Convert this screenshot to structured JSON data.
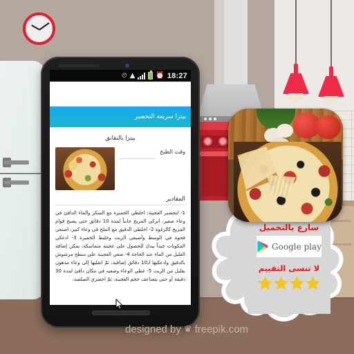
{
  "scene": {
    "title": "Pizza recipe app promo mockup in cartoon kitchen",
    "watermark": {
      "text_before": "designed by",
      "icon": "freepik-crown-icon",
      "text_after": "freepik.com"
    }
  },
  "background": {
    "wall_color": "#b4a79f",
    "floor_color": "#8c6d5c",
    "clock": {
      "name": "wall-clock",
      "rim_color": "#e01f32"
    },
    "fridge": {
      "name": "refrigerator",
      "color": "#e7efeb"
    },
    "stove": {
      "name": "kitchen-stove",
      "color": "#c0202a"
    },
    "hood": {
      "name": "range-hood",
      "color": "#c6c6c6"
    },
    "lamps": [
      {
        "name": "pendant-lamp-left",
        "color": "#ef2a47"
      },
      {
        "name": "pendant-lamp-right",
        "color": "#ef2a47"
      }
    ]
  },
  "phone": {
    "status_bar": {
      "sync_icon": "sync-icon",
      "wifi_icon": "wifi-icon",
      "signal_icon": "signal-bars-icon",
      "battery_icon": "battery-icon",
      "alarm_icon": "alarm-clock-icon",
      "time": "18:27",
      "battery_color": "#8dc63f"
    },
    "app": {
      "appbar_title": "بيتزا سريعة التحضير",
      "appbar_color": "#19a9f0",
      "recipe_title": "بيتزا بالنقانق",
      "cook_time_label": "وقت الطبخ",
      "thumbnail_name": "pizza-thumbnail",
      "ingredients_heading": "المقادير",
      "steps_text": "1- لتحضير العجينة: اخلطي الخميرة مع السكر والماء الدافئ في وعاء صغير، اتركي المزيج جانباً لمدة 10 دقائق حتى يصبح قوام المزيج كالرغوة 2- اخلطي الدقيق مع الملح في وعاء كبير، اصنعي فجوة في الوسط وأضيفي الزيت وخليط الخميرة 3- ادعكي المكونات جيداً بيدكِ للحصول على عجينة متماسكة، يمكن إضافة القليل من الماء عند الحاجة 4- ضعي العجينة على سطح مرشوش بالدقيق وادعكيها لـ10 دقائق إضافية، ثمّ انقليها إلى وعاء مدهون بقليل من الزيت 5- غطي الوعاء وضعيه في مكان دافئ لمدة 30 دقيقة أو حتى يتضاعف حجم العجينة، ثمّ احضري الصلصة."
    },
    "cursor_name": "mouse-cursor"
  },
  "promo": {
    "app_icon_name": "app-icon-pizza",
    "download_cta": "سارع  بالتحميل",
    "store_badge": {
      "name": "google-play-badge",
      "label": "Google play",
      "icon": "google-play-icon"
    },
    "rating_cta": "لا  تنسى  التقييم",
    "stars_filled": 4,
    "star_color": "#f5c518",
    "cta_color": "#f21010",
    "bubble_color": "#d7d7d7"
  }
}
